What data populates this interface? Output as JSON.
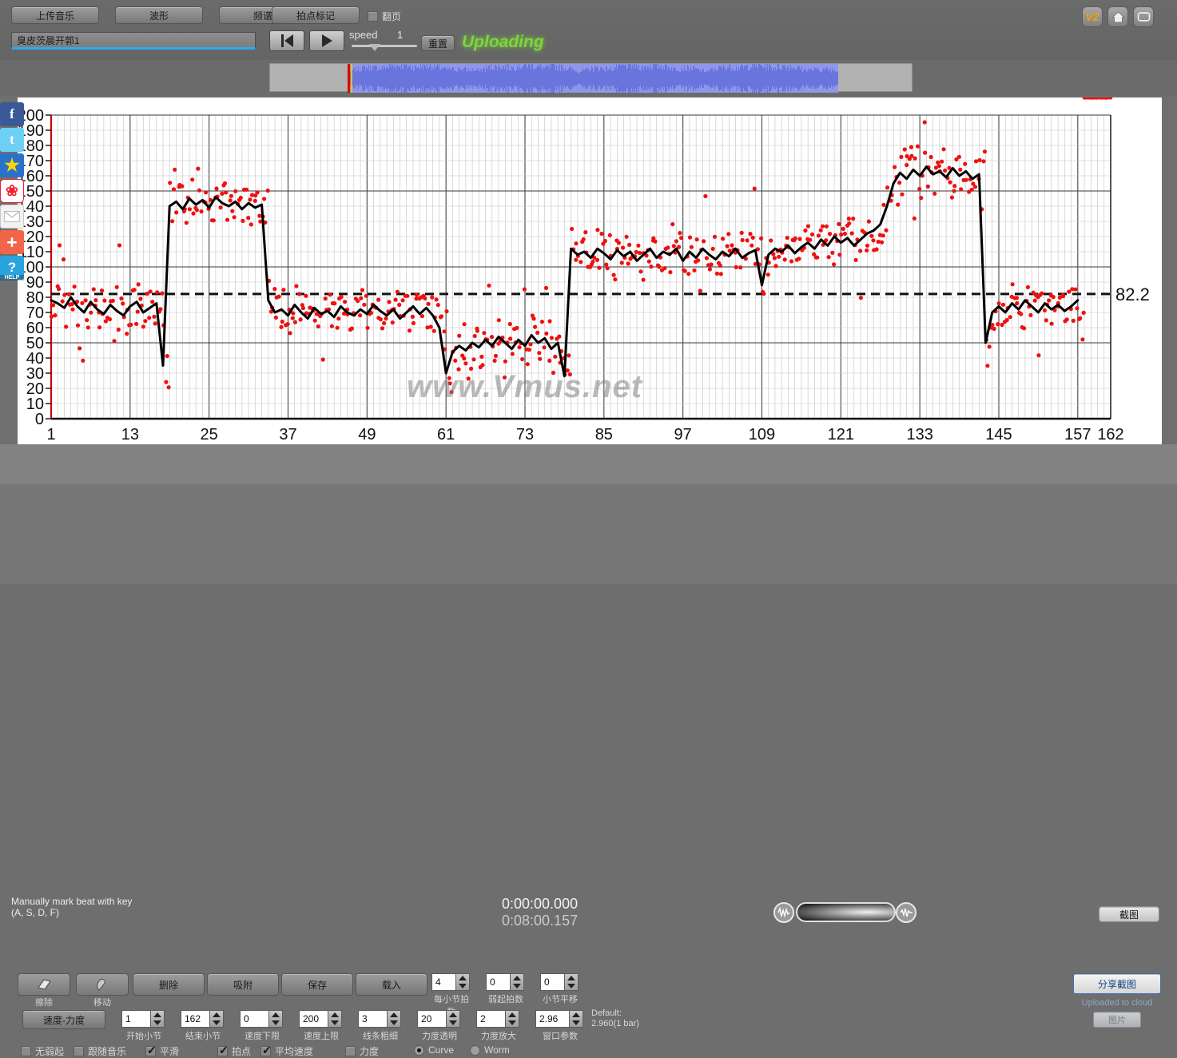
{
  "toolbar": {
    "upload_music": "上传音乐",
    "waveform": "波形",
    "spectrum": "频谱",
    "beat_mark": "拍点标记",
    "flip_page": "翻页",
    "flip_page_checked": false,
    "title_value": "臭皮茨晨开郭1",
    "speed_label": "speed",
    "speed_value": "1",
    "reset": "重置",
    "status": "Uploading",
    "status_color": "#7cd53a",
    "v2_badge": "V2"
  },
  "chart_data": {
    "type": "line",
    "title": "",
    "xlabel": "",
    "ylabel": "",
    "xlim": [
      1,
      162
    ],
    "ylim": [
      0,
      200
    ],
    "xticks": [
      1,
      13,
      25,
      37,
      49,
      61,
      73,
      85,
      97,
      109,
      121,
      133,
      145,
      157,
      162
    ],
    "yticks": [
      0,
      10,
      20,
      30,
      40,
      50,
      60,
      70,
      80,
      90,
      100,
      110,
      120,
      130,
      140,
      150,
      160,
      170,
      180,
      190,
      200
    ],
    "grid": true,
    "average_line": 82.2,
    "average_line_label": "82.2",
    "watermark": "www.Vmus.net",
    "series": [
      {
        "name": "tempo-curve",
        "color": "#000000",
        "x": [
          1,
          2,
          3,
          4,
          5,
          6,
          7,
          8,
          9,
          10,
          11,
          12,
          13,
          14,
          15,
          16,
          17,
          18,
          19,
          20,
          21,
          22,
          23,
          24,
          25,
          26,
          27,
          28,
          29,
          30,
          31,
          32,
          33,
          34,
          35,
          36,
          37,
          38,
          39,
          40,
          41,
          42,
          43,
          44,
          45,
          46,
          47,
          48,
          49,
          50,
          51,
          52,
          53,
          54,
          55,
          56,
          57,
          58,
          59,
          60,
          61,
          62,
          63,
          64,
          65,
          66,
          67,
          68,
          69,
          70,
          71,
          72,
          73,
          74,
          75,
          76,
          77,
          78,
          79,
          80,
          81,
          82,
          83,
          84,
          85,
          86,
          87,
          88,
          89,
          90,
          91,
          92,
          93,
          94,
          95,
          96,
          97,
          98,
          99,
          100,
          101,
          102,
          103,
          104,
          105,
          106,
          107,
          108,
          109,
          110,
          111,
          112,
          113,
          114,
          115,
          116,
          117,
          118,
          119,
          120,
          121,
          122,
          123,
          124,
          125,
          126,
          127,
          128,
          129,
          130,
          131,
          132,
          133,
          134,
          135,
          136,
          137,
          138,
          139,
          140,
          141,
          142,
          143,
          144,
          145,
          146,
          147,
          148,
          149,
          150,
          151,
          152,
          153,
          154,
          155,
          156,
          157,
          158,
          159,
          160,
          161,
          162
        ],
        "values": [
          78,
          76,
          73,
          80,
          74,
          70,
          77,
          72,
          69,
          75,
          71,
          68,
          74,
          77,
          70,
          73,
          76,
          35,
          140,
          143,
          138,
          145,
          141,
          144,
          139,
          146,
          142,
          140,
          143,
          138,
          142,
          139,
          141,
          78,
          70,
          72,
          68,
          75,
          70,
          66,
          73,
          69,
          71,
          67,
          74,
          70,
          68,
          72,
          69,
          75,
          71,
          68,
          72,
          66,
          70,
          74,
          69,
          73,
          68,
          60,
          30,
          44,
          48,
          45,
          50,
          47,
          52,
          48,
          54,
          50,
          46,
          52,
          48,
          55,
          50,
          53,
          46,
          50,
          28,
          112,
          108,
          110,
          106,
          112,
          109,
          105,
          111,
          107,
          110,
          104,
          108,
          112,
          106,
          110,
          108,
          112,
          104,
          110,
          106,
          112,
          108,
          105,
          110,
          107,
          112,
          106,
          109,
          111,
          88,
          108,
          112,
          110,
          114,
          109,
          113,
          116,
          112,
          118,
          114,
          120,
          116,
          119,
          114,
          118,
          122,
          124,
          128,
          140,
          155,
          162,
          158,
          164,
          160,
          166,
          161,
          163,
          159,
          165,
          160,
          163,
          158,
          161,
          50,
          70,
          74,
          70,
          76,
          72,
          78,
          74,
          70,
          76,
          72,
          75,
          71,
          74,
          78
        ]
      },
      {
        "name": "beat-dots",
        "color": "#ee1111",
        "type": "scatter",
        "note": "per-beat tempo samples scattered around the curve, spread roughly ±15 BPM"
      }
    ]
  },
  "mid": {
    "hint_line1": "Manually mark beat with key",
    "hint_line2": "(A, S, D, F)",
    "time_current": "0:00:00.000",
    "time_total": "0:08:00.157",
    "screenshot_button": "截图"
  },
  "bottom": {
    "tools": [
      {
        "name": "erase",
        "label": "擦除"
      },
      {
        "name": "move",
        "label": "移动"
      }
    ],
    "buttons": [
      {
        "name": "delete",
        "label": "删除"
      },
      {
        "name": "absorb",
        "label": "吸附"
      },
      {
        "name": "save",
        "label": "保存"
      },
      {
        "name": "load",
        "label": "载入"
      }
    ],
    "speed_dynamics_button": "速度-力度",
    "spinners_row1": [
      {
        "name": "beats-per-bar",
        "value": "4",
        "caption": "每小节拍数"
      },
      {
        "name": "pickup-beats",
        "value": "0",
        "caption": "弱起拍数"
      },
      {
        "name": "bar-shift",
        "value": "0",
        "caption": "小节平移"
      }
    ],
    "spinners_row2": [
      {
        "name": "start-bar",
        "value": "1",
        "caption": "开始小节"
      },
      {
        "name": "end-bar",
        "value": "162",
        "caption": "结束小节"
      },
      {
        "name": "tempo-min",
        "value": "0",
        "caption": "速度下限"
      },
      {
        "name": "tempo-max",
        "value": "200",
        "caption": "速度上限"
      },
      {
        "name": "line-width",
        "value": "3",
        "caption": "线条粗细"
      },
      {
        "name": "dynamics-alpha",
        "value": "20",
        "caption": "力度透明"
      },
      {
        "name": "dynamics-scale",
        "value": "2",
        "caption": "力度放大"
      },
      {
        "name": "window-param",
        "value": "2.96",
        "caption": "窗口参数"
      }
    ],
    "default_note_line1": "Default:",
    "default_note_line2": "2.960(1 bar)",
    "checkboxes": [
      {
        "name": "no-pickup",
        "label": "无弱起",
        "checked": false
      },
      {
        "name": "follow-music",
        "label": "跟随音乐",
        "checked": false
      },
      {
        "name": "smooth",
        "label": "平滑",
        "checked": true
      },
      {
        "name": "beats",
        "label": "拍点",
        "checked": true
      },
      {
        "name": "average-tempo",
        "label": "平均速度",
        "checked": true
      },
      {
        "name": "dynamics",
        "label": "力度",
        "checked": false
      }
    ],
    "radios": [
      {
        "name": "curve",
        "label": "Curve",
        "selected": true
      },
      {
        "name": "worm",
        "label": "Worm",
        "selected": false
      }
    ],
    "share_button": "分享截图",
    "cloud_note": "Uploaded to cloud",
    "cloud_button": "图片"
  },
  "social": [
    {
      "name": "facebook",
      "glyph": "f"
    },
    {
      "name": "twitter",
      "glyph": "t"
    },
    {
      "name": "qzone",
      "glyph": "★"
    },
    {
      "name": "weibo",
      "glyph": "❀"
    },
    {
      "name": "email",
      "glyph": "✉"
    },
    {
      "name": "share-plus",
      "glyph": "+"
    },
    {
      "name": "help",
      "glyph": "?",
      "sublabel": "HELP"
    }
  ]
}
